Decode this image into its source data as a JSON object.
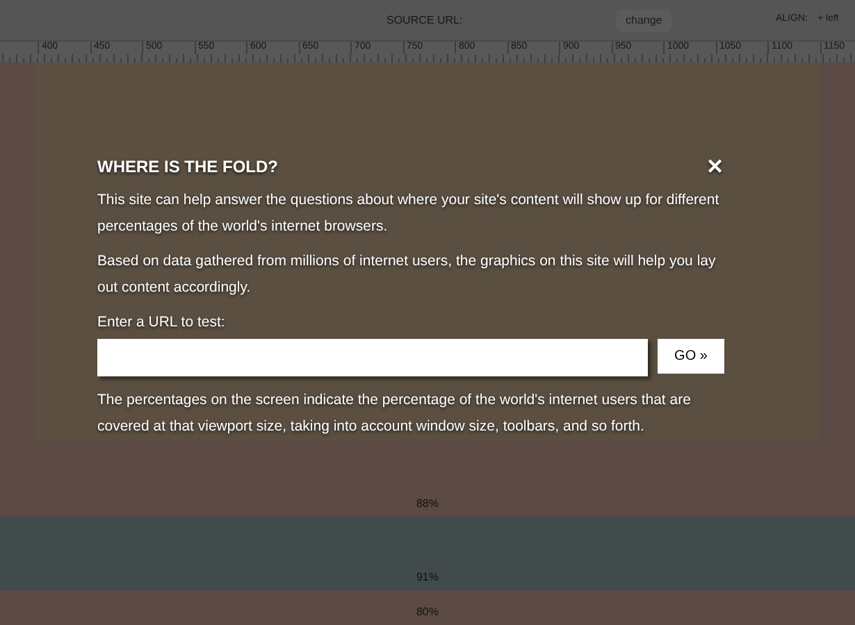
{
  "toolbar": {
    "source_url_label": "SOURCE URL:",
    "change_button": "change",
    "align_label": "ALIGN:",
    "align_value": "+ left"
  },
  "ruler": {
    "labels": [
      "400",
      "450",
      "500",
      "550",
      "600",
      "650",
      "700",
      "750",
      "800",
      "850",
      "900",
      "950",
      "1000",
      "1050",
      "1100",
      "1150"
    ]
  },
  "modal": {
    "title": "WHERE IS THE FOLD?",
    "close": "✕",
    "paragraphs": [
      "This site can help answer the questions about where your site's content will show up for different percentages of the world's internet browsers.",
      "Based on data gathered from millions of internet users, the graphics on this site will help you lay out content accordingly."
    ],
    "url_label": "Enter a URL to test:",
    "go_button": "GO »",
    "footnote": "The percentages on the screen indicate the percentage of the world's internet users that are covered at that viewport size, taking into account window size, toolbars, and so forth."
  },
  "bands": [
    {
      "label": "88%",
      "color": "#5c4a44"
    },
    {
      "label": "91%",
      "color": "#414b4b"
    },
    {
      "label": "80%",
      "color": "#5c4a44"
    }
  ]
}
